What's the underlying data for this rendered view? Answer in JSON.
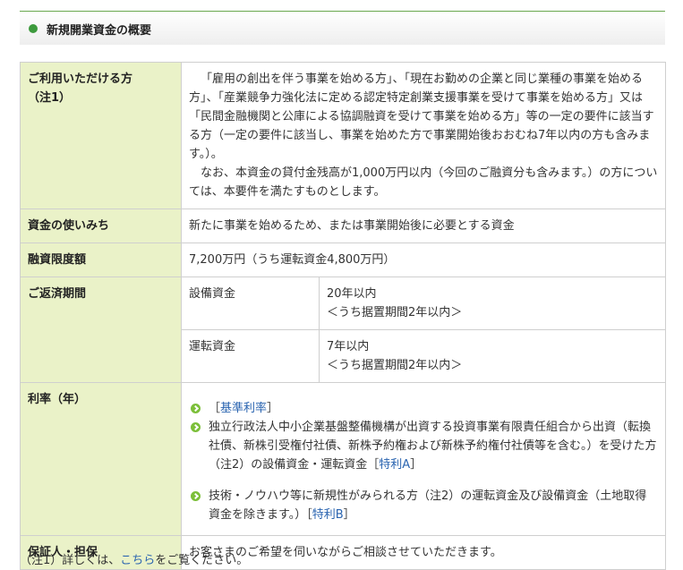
{
  "header": {
    "title": "新規開業資金の概要"
  },
  "rows": {
    "eligible": {
      "label_line1": "ご利用いただける方",
      "label_line2": "（注1）",
      "para1": "「雇用の創出を伴う事業を始める方」、「現在お勤めの企業と同じ業種の事業を始める方」、「産業競争力強化法に定める認定特定創業支援事業を受けて事業を始める方」又は「民間金融機関と公庫による協調融資を受けて事業を始める方」等の一定の要件に該当する方（一定の要件に該当し、事業を始めた方で事業開始後おおむね7年以内の方も含みます。）。",
      "para2": "なお、本資金の貸付金残高が1,000万円以内（今回のご融資分も含みます。）の方については、本要件を満たすものとします。"
    },
    "usage": {
      "label": "資金の使いみち",
      "value": "新たに事業を始めるため、または事業開始後に必要とする資金"
    },
    "limit": {
      "label": "融資限度額",
      "value": "7,200万円（うち運転資金4,800万円）"
    },
    "repayment": {
      "label": "ご返済期間",
      "equipment_label": "設備資金",
      "equipment_term": "20年以内",
      "equipment_grace": "＜うち据置期間2年以内＞",
      "operating_label": "運転資金",
      "operating_term": "7年以内",
      "operating_grace": "＜うち据置期間2年以内＞"
    },
    "rate": {
      "label": "利率（年）",
      "item1_pre": "［",
      "item1_link": "基準利率",
      "item1_post": "］",
      "item2_text": "独立行政法人中小企業基盤整備機構が出資する投資事業有限責任組合から出資（転換社債、新株引受権付社債、新株予約権および新株予約権付社債等を含む。）を受けた方（注2）の設備資金・運転資金［",
      "item2_link": "特利A",
      "item2_post": "］",
      "item3_text": "技術・ノウハウ等に新規性がみられる方（注2）の運転資金及び設備資金（土地取得資金を除きます。）［",
      "item3_link": "特利B",
      "item3_post": "］"
    },
    "guarantor": {
      "label": "保証人・担保",
      "value": "お客さまのご希望を伺いながらご相談させていただきます。"
    }
  },
  "footnote": {
    "prefix": "（注1）詳しくは、",
    "link": "こちら",
    "suffix": "をご覧ください。"
  }
}
